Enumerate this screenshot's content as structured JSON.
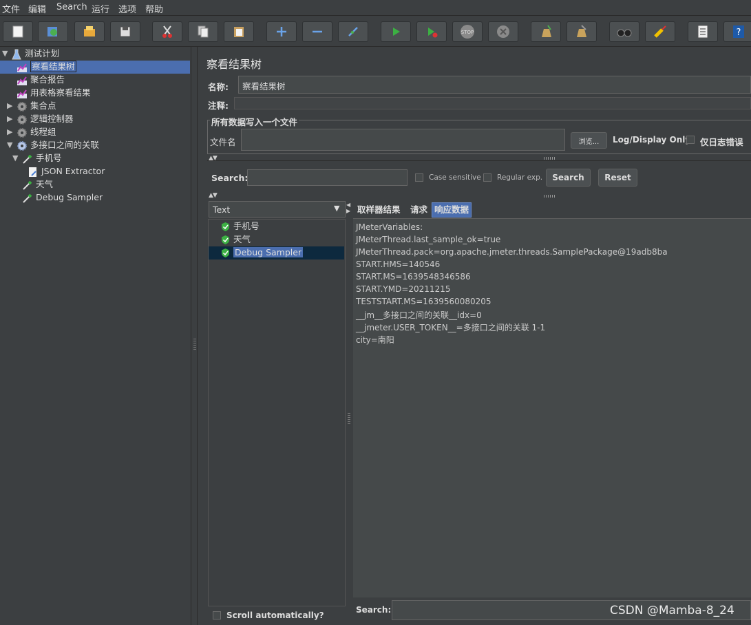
{
  "menu": [
    "文件",
    "编辑",
    "Search",
    "运行",
    "选项",
    "帮助"
  ],
  "toolbar": {
    "buttons": [
      "new-icon",
      "templates-icon",
      "open-icon",
      "save-icon",
      "cut-icon",
      "copy-icon",
      "paste-icon",
      "expand-icon",
      "collapse-icon",
      "toggle-icon",
      "start-icon",
      "start-no-pause-icon",
      "stop-icon",
      "shutdown-icon",
      "clear-icon",
      "clear-all-icon",
      "search-icon",
      "reset-search-icon",
      "function-helper-icon",
      "help-icon"
    ],
    "stop_label": "STOP"
  },
  "tree": {
    "root": "测试计划",
    "items": [
      {
        "label": "察看结果树",
        "selected": true
      },
      {
        "label": "聚合报告"
      },
      {
        "label": "用表格察看结果"
      },
      {
        "label": "集合点"
      },
      {
        "label": "逻辑控制器"
      },
      {
        "label": "线程组"
      },
      {
        "label": "多接口之间的关联"
      },
      {
        "label": "手机号"
      },
      {
        "label": "JSON Extractor"
      },
      {
        "label": "天气"
      },
      {
        "label": "Debug Sampler"
      }
    ]
  },
  "panel": {
    "title": "察看结果树",
    "name_label": "名称:",
    "name_value": "察看结果树",
    "comment_label": "注释:",
    "comment_value": "",
    "file_group_title": "所有数据写入一个文件",
    "filename_label": "文件名",
    "filename_value": "",
    "browse_button": "浏览...",
    "log_display_label": "Log/Display Only:",
    "errors_only_label": "仅日志错误"
  },
  "search": {
    "label": "Search:",
    "value": "",
    "case_sensitive": "Case sensitive",
    "regular_exp": "Regular exp.",
    "search_button": "Search",
    "reset_button": "Reset"
  },
  "results": {
    "renderer": "Text",
    "samples": [
      {
        "label": "手机号"
      },
      {
        "label": "天气"
      },
      {
        "label": "Debug Sampler",
        "selected": true
      }
    ],
    "scroll_auto": "Scroll automatically?"
  },
  "tabs": [
    "取样器结果",
    "请求",
    "响应数据"
  ],
  "response_lines": [
    "JMeterVariables:",
    "JMeterThread.last_sample_ok=true",
    "JMeterThread.pack=org.apache.jmeter.threads.SamplePackage@19adb8ba",
    "START.HMS=140546",
    "START.MS=1639548346586",
    "START.YMD=20211215",
    "TESTSTART.MS=1639560080205",
    "__jm__多接口之间的关联__idx=0",
    "__jmeter.USER_TOKEN__=多接口之间的关联 1-1",
    "city=南阳"
  ],
  "bottom_search_label": "Search:",
  "watermark": "CSDN @Mamba-8_24"
}
